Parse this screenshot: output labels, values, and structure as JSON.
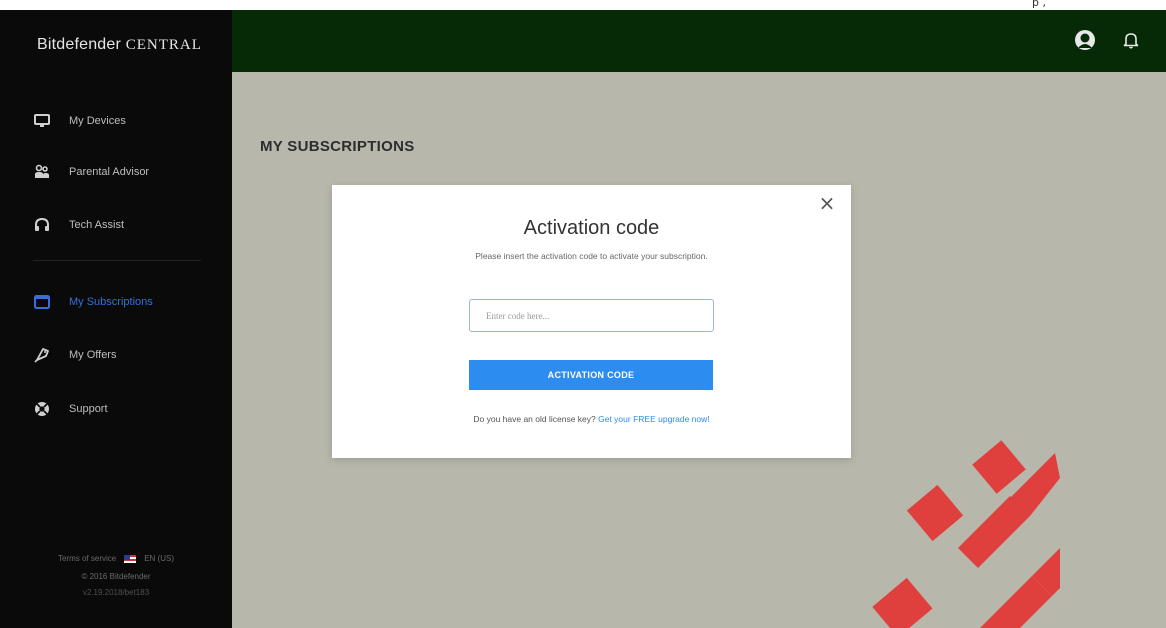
{
  "top_strip": {
    "text": "p   ,  "
  },
  "brand": {
    "part1": "Bitdefender",
    "part2": "CENTRAL"
  },
  "sidebar": {
    "items": [
      {
        "label": "My Devices",
        "icon": "monitor-icon"
      },
      {
        "label": "Parental Advisor",
        "icon": "family-icon"
      },
      {
        "label": "Tech Assist",
        "icon": "headset-icon"
      },
      {
        "label": "My Subscriptions",
        "icon": "calendar-icon",
        "active": true
      },
      {
        "label": "My Offers",
        "icon": "tag-icon"
      },
      {
        "label": "Support",
        "icon": "lifebuoy-icon"
      }
    ],
    "footer": {
      "terms": "Terms of service",
      "lang": "EN (US)",
      "copyright": "© 2016 Bitdefender",
      "version": "v2.19.2018/bet183"
    }
  },
  "page": {
    "title": "MY SUBSCRIPTIONS"
  },
  "modal": {
    "title": "Activation code",
    "subtitle": "Please insert the activation code to activate your subscription.",
    "input_placeholder": "Enter code here...",
    "button_label": "ACTIVATION CODE",
    "upgrade_text": "Do you have an old license key?",
    "upgrade_link": "Get your FREE upgrade now!"
  },
  "colors": {
    "sidebar_bg": "#0a0a0a",
    "topbar_bg": "#072a06",
    "main_bg": "#b7b8ab",
    "accent": "#2d8cf0",
    "active_nav": "#3a6fd8",
    "watermark": "#e0403d"
  }
}
